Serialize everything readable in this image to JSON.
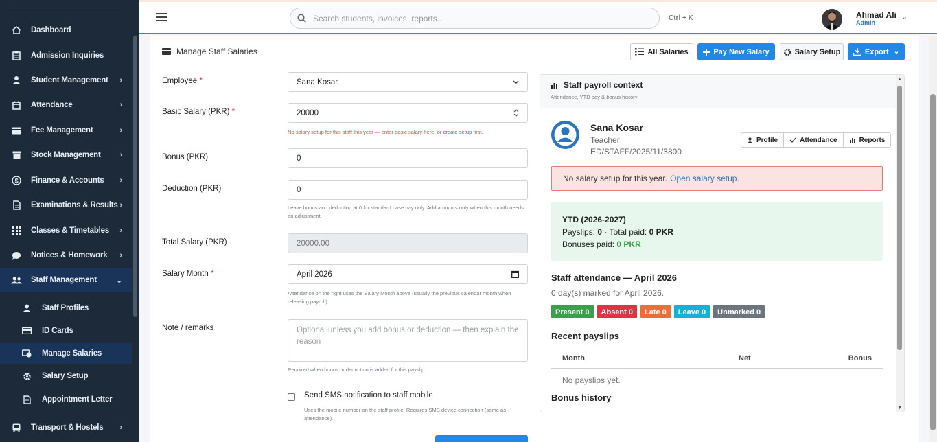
{
  "sidebar": {
    "items": [
      {
        "label": "Dashboard",
        "icon": "home-icon",
        "chevron": ""
      },
      {
        "label": "Admission Inquiries",
        "icon": "clipboard-icon",
        "chevron": ""
      },
      {
        "label": "Student Management",
        "icon": "student-icon",
        "chevron": "›"
      },
      {
        "label": "Attendance",
        "icon": "calendar-icon",
        "chevron": "›"
      },
      {
        "label": "Fee Management",
        "icon": "card-icon",
        "chevron": "›"
      },
      {
        "label": "Stock Management",
        "icon": "box-icon",
        "chevron": "›"
      },
      {
        "label": "Finance & Accounts",
        "icon": "dollar-icon",
        "chevron": "›"
      },
      {
        "label": "Examinations & Results",
        "icon": "document-icon",
        "chevron": "›"
      },
      {
        "label": "Classes & Timetables",
        "icon": "grid-icon",
        "chevron": "›"
      },
      {
        "label": "Notices & Homework",
        "icon": "chat-icon",
        "chevron": "›"
      },
      {
        "label": "Staff Management",
        "icon": "users-icon",
        "chevron": "⌄"
      },
      {
        "label": "Transport & Hostels",
        "icon": "bus-icon",
        "chevron": "›"
      }
    ],
    "subitems": [
      {
        "label": "Staff Profiles",
        "icon": "user-icon"
      },
      {
        "label": "ID Cards",
        "icon": "id-card-icon"
      },
      {
        "label": "Manage Salaries",
        "icon": "money-icon"
      },
      {
        "label": "Salary Setup",
        "icon": "gear-icon"
      },
      {
        "label": "Appointment Letter",
        "icon": "file-icon"
      }
    ]
  },
  "topbar": {
    "search_placeholder": "Search students, invoices, reports...",
    "shortcut": "Ctrl + K",
    "user_name": "Ahmad Ali",
    "user_role": "Admin"
  },
  "page": {
    "title": "Manage Staff Salaries",
    "buttons": {
      "all_salaries": "All Salaries",
      "pay_new_salary": "Pay New Salary",
      "salary_setup": "Salary Setup",
      "export": "Export"
    }
  },
  "form": {
    "employee_label": "Employee",
    "employee_value": "Sana Kosar",
    "basic_label": "Basic Salary (PKR)",
    "basic_value": "20000",
    "basic_help_pre": "No salary setup for this staff this year — enter basic salary here, or",
    "basic_help_link": "create setup",
    "basic_help_post": "first.",
    "bonus_label": "Bonus (PKR)",
    "bonus_value": "0",
    "deduction_label": "Deduction (PKR)",
    "deduction_value": "0",
    "deduction_help": "Leave bonus and deduction at 0 for standard base pay only. Add amounts only when this month needs an adjustment.",
    "total_label": "Total Salary (PKR)",
    "total_value": "20000.00",
    "month_label": "Salary Month",
    "month_value": "April 2026",
    "month_help": "Attendance on the right uses the Salary Month above (usually the previous calendar month when releasing payroll).",
    "note_label": "Note / remarks",
    "note_placeholder": "Optional unless you add bonus or deduction — then explain the reason",
    "note_help": "Required when bonus or deduction is added for this payslip.",
    "sms_label": "Send SMS notification to staff mobile",
    "sms_help": "Uses the mobile number on the staff profile. Requires SMS device connection (same as attendance)."
  },
  "context": {
    "title": "Staff payroll context",
    "subtitle": "Attendance, YTD pay & bonus history",
    "name": "Sana Kosar",
    "role": "Teacher",
    "staff_id": "ED/STAFF/2025/11/3800",
    "buttons": {
      "profile": "Profile",
      "attendance": "Attendance",
      "reports": "Reports"
    },
    "alert_text": "No salary setup for this year.",
    "alert_link": "Open salary setup.",
    "ytd_title": "YTD (2026-2027)",
    "payslips_label": "Payslips:",
    "payslips_value": "0",
    "total_paid_label": "· Total paid:",
    "total_paid_value": "0 PKR",
    "bonuses_label": "Bonuses paid:",
    "bonuses_value": "0 PKR",
    "attendance_title": "Staff attendance — April 2026",
    "attendance_sub": "0 day(s) marked for April 2026.",
    "badges": [
      {
        "label": "Present 0",
        "color": "#3aa14a"
      },
      {
        "label": "Absent 0",
        "color": "#dc3545"
      },
      {
        "label": "Late 0",
        "color": "#f26b3a"
      },
      {
        "label": "Leave 0",
        "color": "#17b0d3"
      },
      {
        "label": "Unmarked 0",
        "color": "#6c757d"
      }
    ],
    "recent_title": "Recent payslips",
    "table_headers": {
      "month": "Month",
      "net": "Net",
      "bonus": "Bonus"
    },
    "empty_text": "No payslips yet.",
    "bonus_history_title": "Bonus history"
  },
  "colors": {
    "accent": "#2188e8",
    "sidebar": "#1c2a3a",
    "active": "#1a3358"
  }
}
